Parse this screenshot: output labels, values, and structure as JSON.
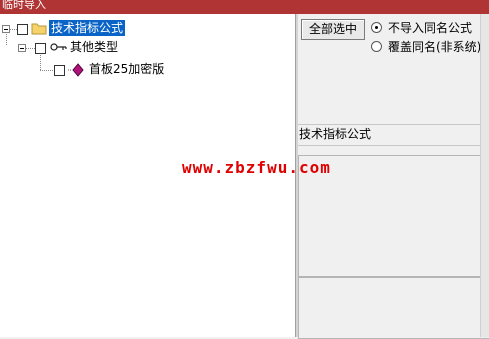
{
  "window": {
    "title": "临时导入"
  },
  "tree": {
    "root": {
      "label": "技术指标公式",
      "icon": "folder-icon"
    },
    "child": {
      "label": "其他类型",
      "icon": "key-icon"
    },
    "leaf": {
      "label": "首板25加密版",
      "icon": "diamond-icon"
    }
  },
  "actions": {
    "select_all_label": "全部选中"
  },
  "options": [
    {
      "label": "不导入同名公式",
      "selected": true
    },
    {
      "label": "覆盖同名(非系统)",
      "selected": false
    }
  ],
  "details": {
    "name_label": "技术指标公式"
  },
  "watermark": "www.zbzfwu.com",
  "colors": {
    "titlebar": "#b03434",
    "selection": "#0a64c8",
    "watermark": "#e00000"
  }
}
